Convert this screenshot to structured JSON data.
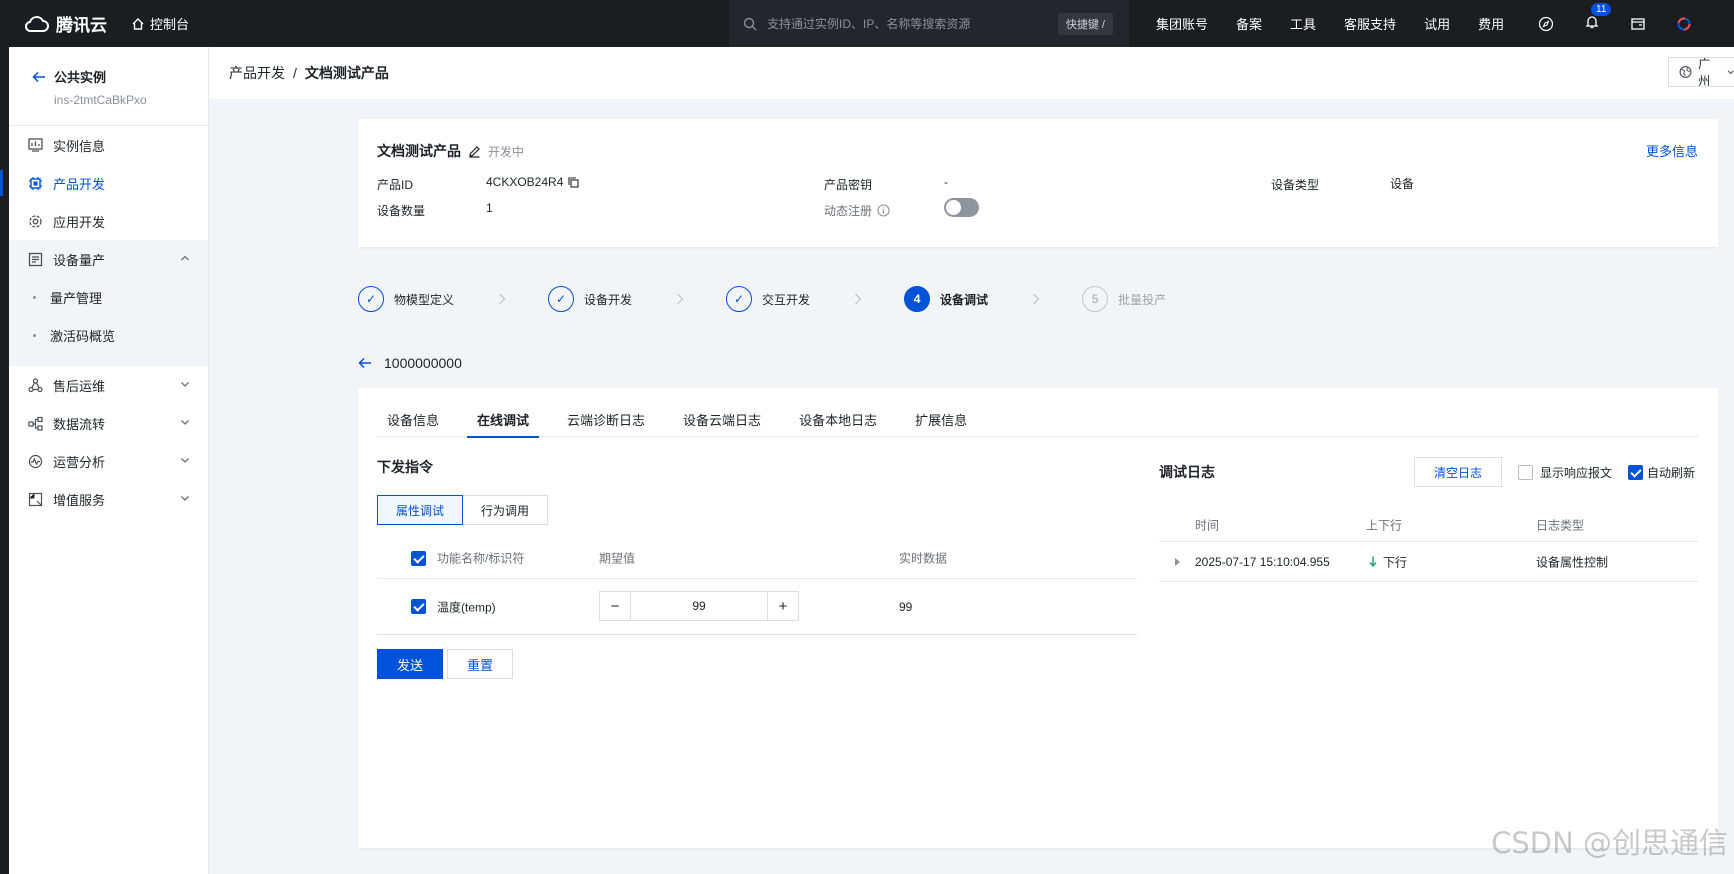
{
  "topbar": {
    "brand": "腾讯云",
    "console": "控制台",
    "search_placeholder": "支持通过实例ID、IP、名称等搜索资源",
    "shortcut": "快捷键 /",
    "nav": [
      "集团账号",
      "备案",
      "工具",
      "客服支持",
      "试用",
      "费用"
    ],
    "notify_count": "11"
  },
  "sidebar": {
    "title": "公共实例",
    "instance_id": "ins-2tmtCaBkPxo",
    "items": [
      {
        "label": "实例信息",
        "icon": "monitor-icon"
      },
      {
        "label": "产品开发",
        "icon": "chip-icon",
        "active": true
      },
      {
        "label": "应用开发",
        "icon": "gear-icon"
      },
      {
        "label": "设备量产",
        "icon": "list-icon"
      }
    ],
    "sub_items": [
      "量产管理",
      "激活码概览"
    ],
    "more_items": [
      "售后运维",
      "数据流转",
      "运营分析",
      "增值服务"
    ]
  },
  "breadcrumb": {
    "parent": "产品开发",
    "sep": "/",
    "current": "文档测试产品"
  },
  "region": "广州",
  "product": {
    "name": "文档测试产品",
    "status": "开发中",
    "more": "更多信息",
    "id_label": "产品ID",
    "id_value": "4CKXOB24R4",
    "secret_label": "产品密钥",
    "secret_value": "-",
    "type_label": "设备类型",
    "type_value": "设备",
    "count_label": "设备数量",
    "count_value": "1",
    "dynreg_label": "动态注册"
  },
  "steps": [
    {
      "num": "✓",
      "label": "物模型定义"
    },
    {
      "num": "✓",
      "label": "设备开发"
    },
    {
      "num": "✓",
      "label": "交互开发"
    },
    {
      "num": "4",
      "label": "设备调试"
    },
    {
      "num": "5",
      "label": "批量投产"
    }
  ],
  "device_name": "1000000000",
  "tabs": [
    "设备信息",
    "在线调试",
    "云端诊断日志",
    "设备云端日志",
    "设备本地日志",
    "扩展信息"
  ],
  "command": {
    "title": "下发指令",
    "seg_attr": "属性调试",
    "seg_action": "行为调用",
    "col_name": "功能名称/标识符",
    "col_expected": "期望值",
    "col_realtime": "实时数据",
    "row_name": "温度(temp)",
    "row_value": "99",
    "row_realtime": "99",
    "send": "发送",
    "reset": "重置"
  },
  "log": {
    "title": "调试日志",
    "clear": "清空日志",
    "show_resp": "显示响应报文",
    "auto_refresh": "自动刷新",
    "col_time": "时间",
    "col_dir": "上下行",
    "col_type": "日志类型",
    "row_time": "2025-07-17 15:10:04.955",
    "row_dir": "下行",
    "row_type": "设备属性控制"
  },
  "watermark": "CSDN @创思通信",
  "colors": {
    "accent": "#0052d9",
    "topbar": "#1b1d21",
    "down_arrow": "#2ba471"
  }
}
